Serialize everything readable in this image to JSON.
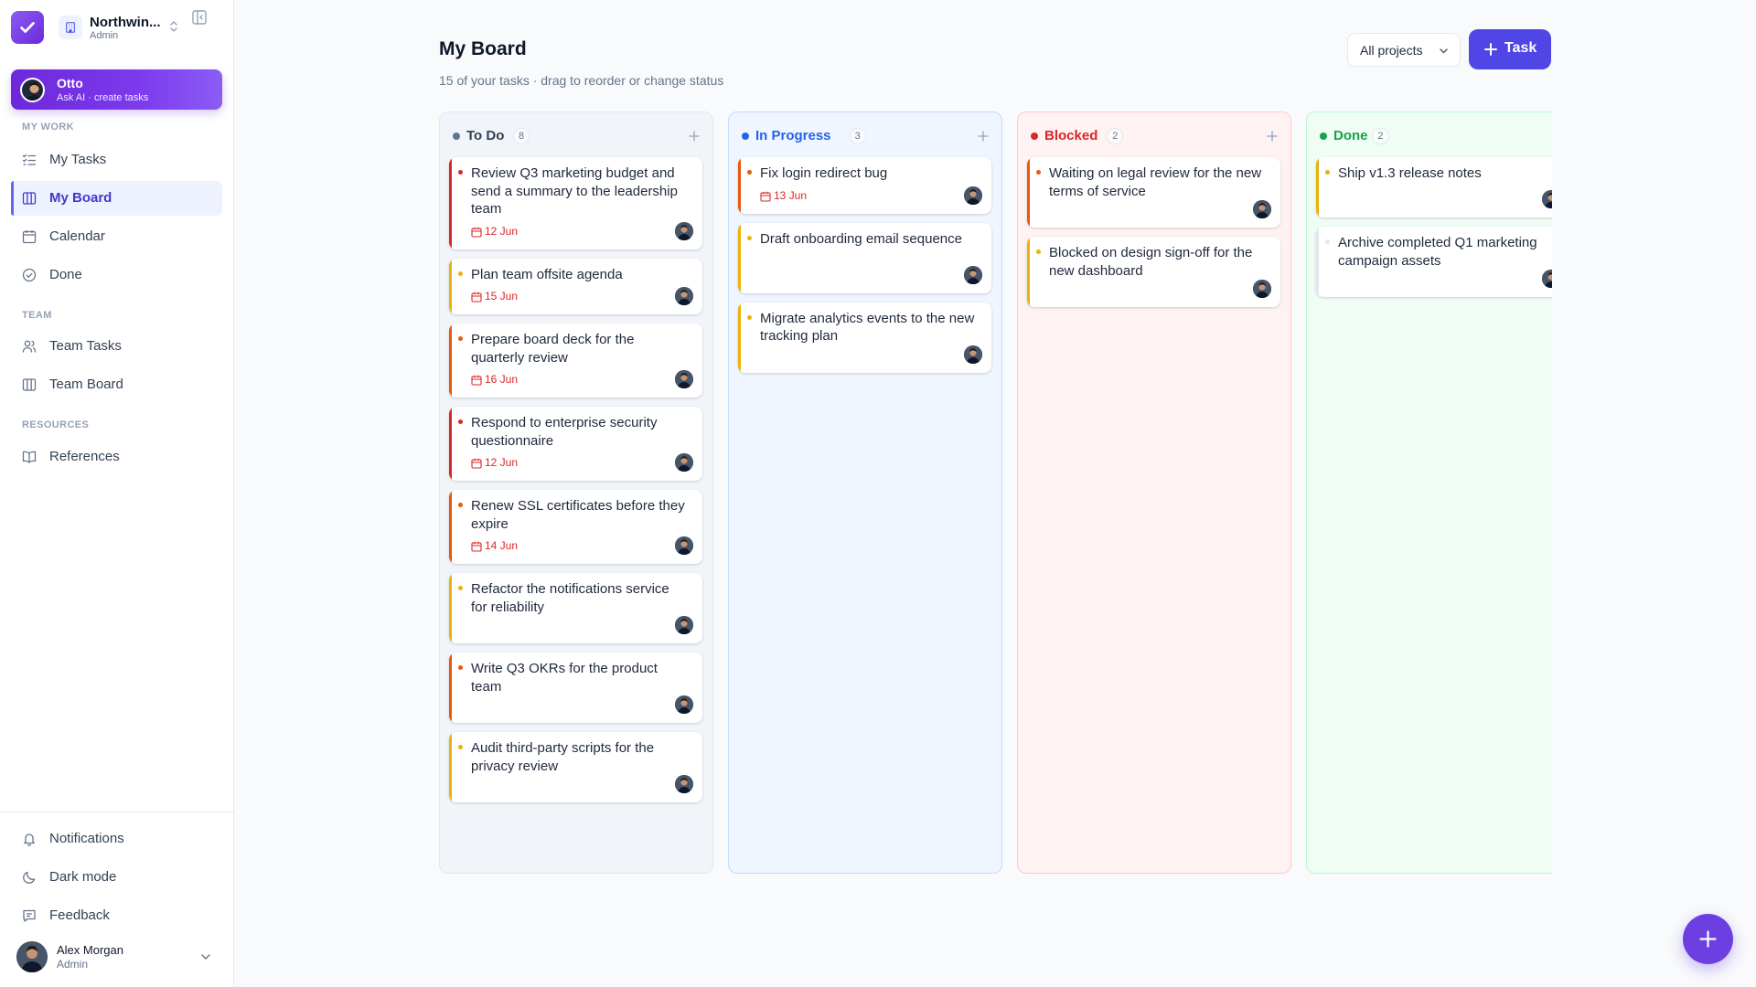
{
  "workspace": {
    "name": "Northwin...",
    "role": "Admin"
  },
  "assistant": {
    "name": "Otto",
    "subtitle": "Ask AI · create tasks"
  },
  "sidebar": {
    "sections": [
      {
        "title": "MY WORK"
      },
      {
        "title": "TEAM"
      },
      {
        "title": "RESOURCES"
      }
    ],
    "items": [
      {
        "label": "My Tasks",
        "icon": "list-check-icon"
      },
      {
        "label": "My Board",
        "icon": "board-icon",
        "active": true
      },
      {
        "label": "Calendar",
        "icon": "calendar-icon"
      },
      {
        "label": "Done",
        "icon": "check-circle-icon"
      },
      {
        "label": "Team Tasks",
        "icon": "users-icon"
      },
      {
        "label": "Team Board",
        "icon": "board-icon"
      },
      {
        "label": "References",
        "icon": "book-icon"
      }
    ],
    "footer": [
      {
        "label": "Notifications",
        "icon": "bell-icon"
      },
      {
        "label": "Dark mode",
        "icon": "moon-icon"
      },
      {
        "label": "Feedback",
        "icon": "message-icon"
      }
    ]
  },
  "user": {
    "name": "Alex Morgan",
    "role": "Admin"
  },
  "header": {
    "title": "My Board",
    "subtitle": "15 of your tasks · drag to reorder or change status",
    "project_filter": "All projects",
    "new_task_label": "Task"
  },
  "columns": [
    {
      "title": "To Do",
      "count": "8",
      "color": "#64748b",
      "cards": [
        {
          "title": "Review Q3 marketing budget and send a summary to the leadership team",
          "due": "12 Jun",
          "priority": "high"
        },
        {
          "title": "Plan team offsite agenda",
          "due": "15 Jun",
          "priority": "low"
        },
        {
          "title": "Prepare board deck for the quarterly review",
          "due": "16 Jun",
          "priority": "medium"
        },
        {
          "title": "Respond to enterprise security questionnaire",
          "due": "12 Jun",
          "priority": "high"
        },
        {
          "title": "Renew SSL certificates before they expire",
          "due": "14 Jun",
          "priority": "medium"
        },
        {
          "title": "Refactor the notifications service for reliability",
          "due": "",
          "priority": "low"
        },
        {
          "title": "Write Q3 OKRs for the product team",
          "due": "",
          "priority": "medium"
        },
        {
          "title": "Audit third-party scripts for the privacy review",
          "due": "",
          "priority": "low"
        }
      ]
    },
    {
      "title": "In Progress",
      "count": "3",
      "color": "#2563eb",
      "cards": [
        {
          "title": "Fix login redirect bug",
          "due": "13 Jun",
          "priority": "medium"
        },
        {
          "title": "Draft onboarding email sequence",
          "due": "",
          "priority": "low"
        },
        {
          "title": "Migrate analytics events to the new tracking plan",
          "due": "",
          "priority": "low"
        }
      ]
    },
    {
      "title": "Blocked",
      "count": "2",
      "color": "#dc2626",
      "cards": [
        {
          "title": "Waiting on legal review for the new terms of service",
          "due": "",
          "priority": "medium"
        },
        {
          "title": "Blocked on design sign-off for the new dashboard",
          "due": "",
          "priority": "low"
        }
      ]
    },
    {
      "title": "Done",
      "count": "2",
      "color": "#16a34a",
      "cards": [
        {
          "title": "Ship v1.3 release notes",
          "due": "",
          "priority": "low"
        },
        {
          "title": "Archive completed Q1 marketing campaign assets",
          "due": "",
          "priority": "none"
        }
      ]
    }
  ],
  "colors": {
    "accent": "#4f46e5",
    "priority_high": "#dc2626",
    "priority_medium": "#ea580c",
    "priority_low": "#eab308",
    "priority_none": "#e2e8f0"
  }
}
